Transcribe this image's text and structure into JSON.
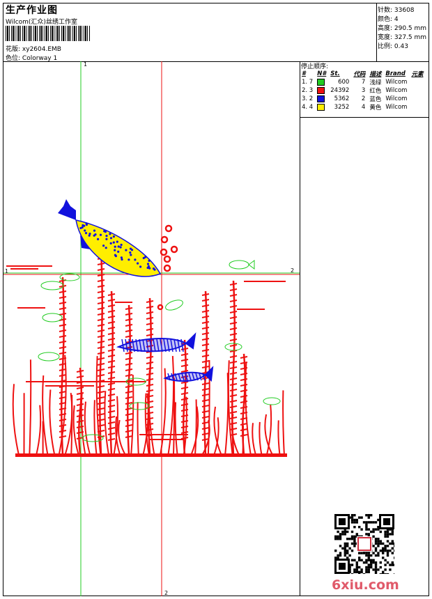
{
  "header": {
    "title": "生产作业图",
    "subtitle": "Wilcom(汇众)丝绣工作室",
    "design_label": "花版:",
    "design_value": "xy2604.EMB",
    "colorway_label": "色位:",
    "colorway_value": "Colorway 1"
  },
  "info": {
    "stitches": "针数: 33608",
    "colors": "颜色: 4",
    "height": "高度: 290.5 mm",
    "width": "宽度: 327.5 mm",
    "scale": "比例: 0.43"
  },
  "stop_sequence": {
    "title": "停止顺序:",
    "columns": [
      "#",
      "N#",
      "St.",
      "代码",
      "描述",
      "Brand",
      "元素"
    ],
    "rows": [
      {
        "idx": "1. 7",
        "color": "#22cc22",
        "stitches": "600",
        "code": "7",
        "desc": "浅绿",
        "brand": "Wilcom"
      },
      {
        "idx": "2. 3",
        "color": "#ee1111",
        "stitches": "24392",
        "code": "3",
        "desc": "红色",
        "brand": "Wilcom"
      },
      {
        "idx": "3. 2",
        "color": "#1111dd",
        "stitches": "5362",
        "code": "2",
        "desc": "蓝色",
        "brand": "Wilcom"
      },
      {
        "idx": "4. 4",
        "color": "#ffee00",
        "stitches": "3252",
        "code": "4",
        "desc": "黄色",
        "brand": "Wilcom"
      }
    ]
  },
  "axis": {
    "x_start": "1",
    "x_end": "2",
    "y_start": "1",
    "y_end": "2"
  },
  "watermark": "6xiu.com",
  "colors": {
    "green": "#22cc22",
    "red": "#ee1111",
    "blue": "#1111dd",
    "yellow": "#ffee00"
  }
}
